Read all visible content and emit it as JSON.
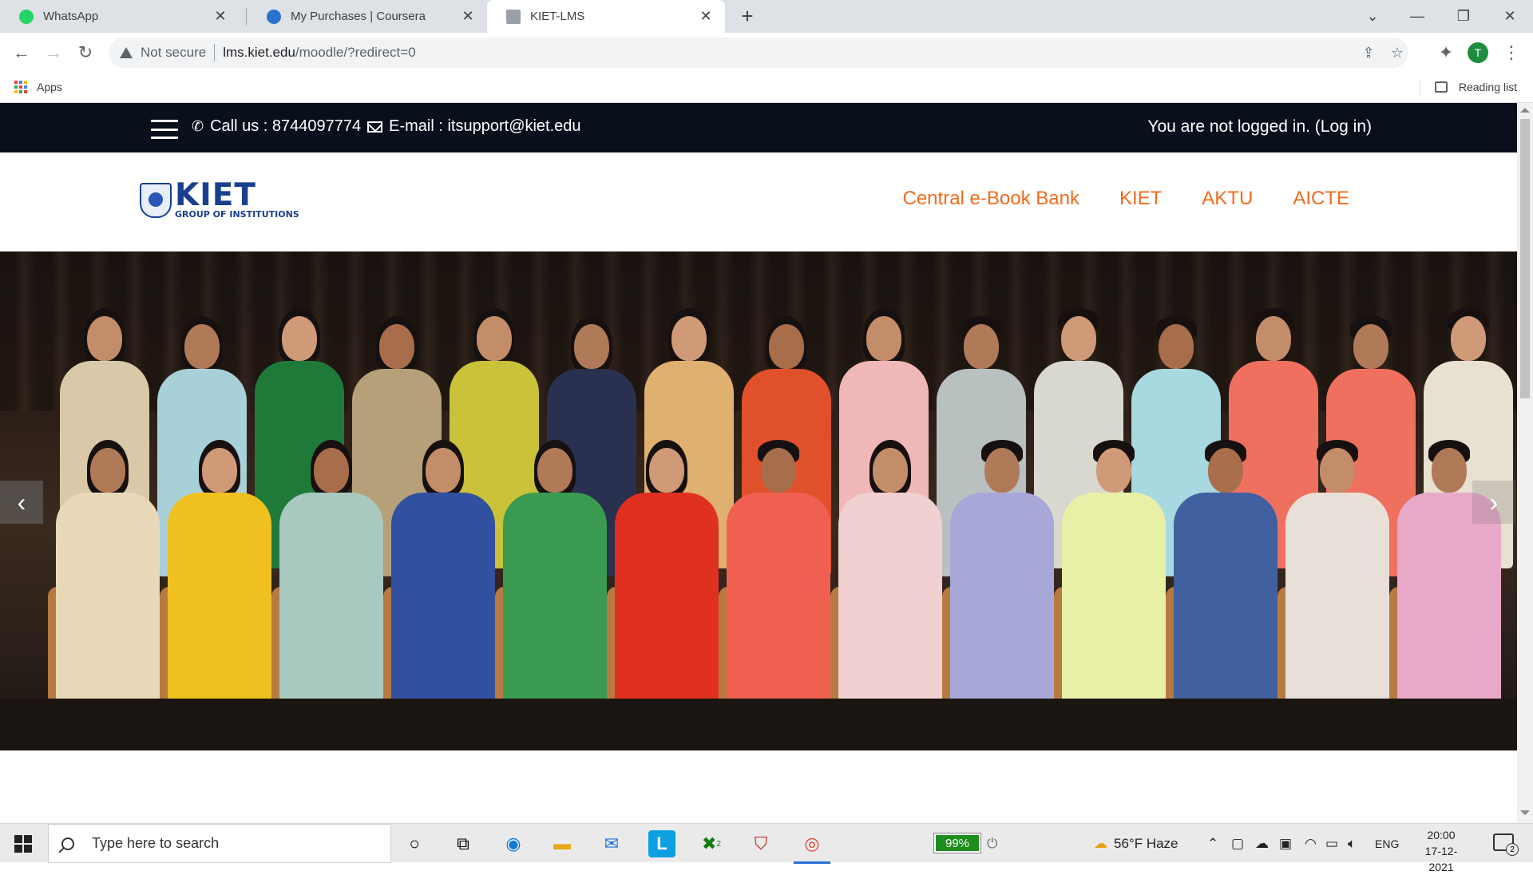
{
  "browser": {
    "tabs": [
      {
        "title": "WhatsApp",
        "icon": "whatsapp-icon",
        "color": "#25d366"
      },
      {
        "title": "My Purchases | Coursera",
        "icon": "coursera-icon",
        "color": "#2a73cc"
      },
      {
        "title": "KIET-LMS",
        "icon": "document-icon",
        "color": "#9aa0a6"
      }
    ],
    "new_tab_label": "+",
    "address": {
      "security_label": "Not secure",
      "host": "lms.kiet.edu",
      "path": "/moodle/?redirect=0"
    },
    "profile_initial": "T",
    "bookmarks": {
      "apps_label": "Apps",
      "reading_list_label": "Reading list"
    }
  },
  "site": {
    "topbar": {
      "call_label": "Call us : 8744097774",
      "email_label": "E-mail : itsupport@kiet.edu",
      "login_status": "You are not logged in. (Log in)"
    },
    "logo": {
      "name": "KIET",
      "subtitle": "GROUP OF INSTITUTIONS"
    },
    "nav": [
      {
        "label": "Central e-Book Bank"
      },
      {
        "label": "KIET"
      },
      {
        "label": "AKTU"
      },
      {
        "label": "AICTE"
      }
    ],
    "carousel": {
      "prev_label": "‹",
      "next_label": "›"
    },
    "accent_color": "#f26b1d",
    "topbar_color": "#0a0f1c"
  },
  "taskbar": {
    "search_placeholder": "Type here to search",
    "battery_label": "99%",
    "weather": "56°F  Haze",
    "language": "ENG",
    "time": "20:00",
    "date": "17-12-2021",
    "notification_count": "2",
    "mail_badge": "2"
  }
}
